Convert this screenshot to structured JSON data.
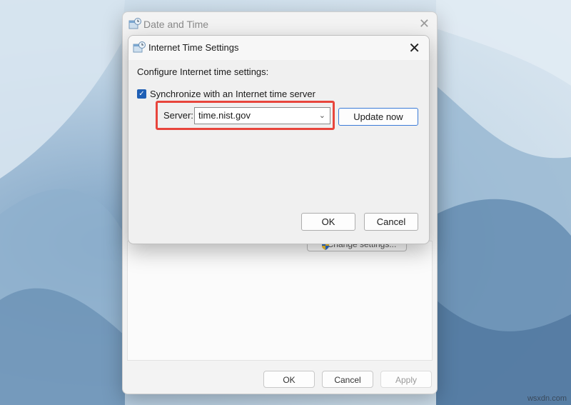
{
  "background_window": {
    "title": "Date and Time",
    "change_settings_label": "Change settings...",
    "ok_label": "OK",
    "cancel_label": "Cancel",
    "apply_label": "Apply"
  },
  "dialog": {
    "title": "Internet Time Settings",
    "configure_label": "Configure Internet time settings:",
    "sync_checkbox": {
      "label": "Synchronize with an Internet time server",
      "checked": true
    },
    "server_label": "Server:",
    "server_value": "time.nist.gov",
    "update_now_label": "Update now",
    "ok_label": "OK",
    "cancel_label": "Cancel"
  },
  "colors": {
    "highlight": "#e8453c",
    "accent": "#1f5fb5"
  },
  "watermark": "wsxdn.com"
}
